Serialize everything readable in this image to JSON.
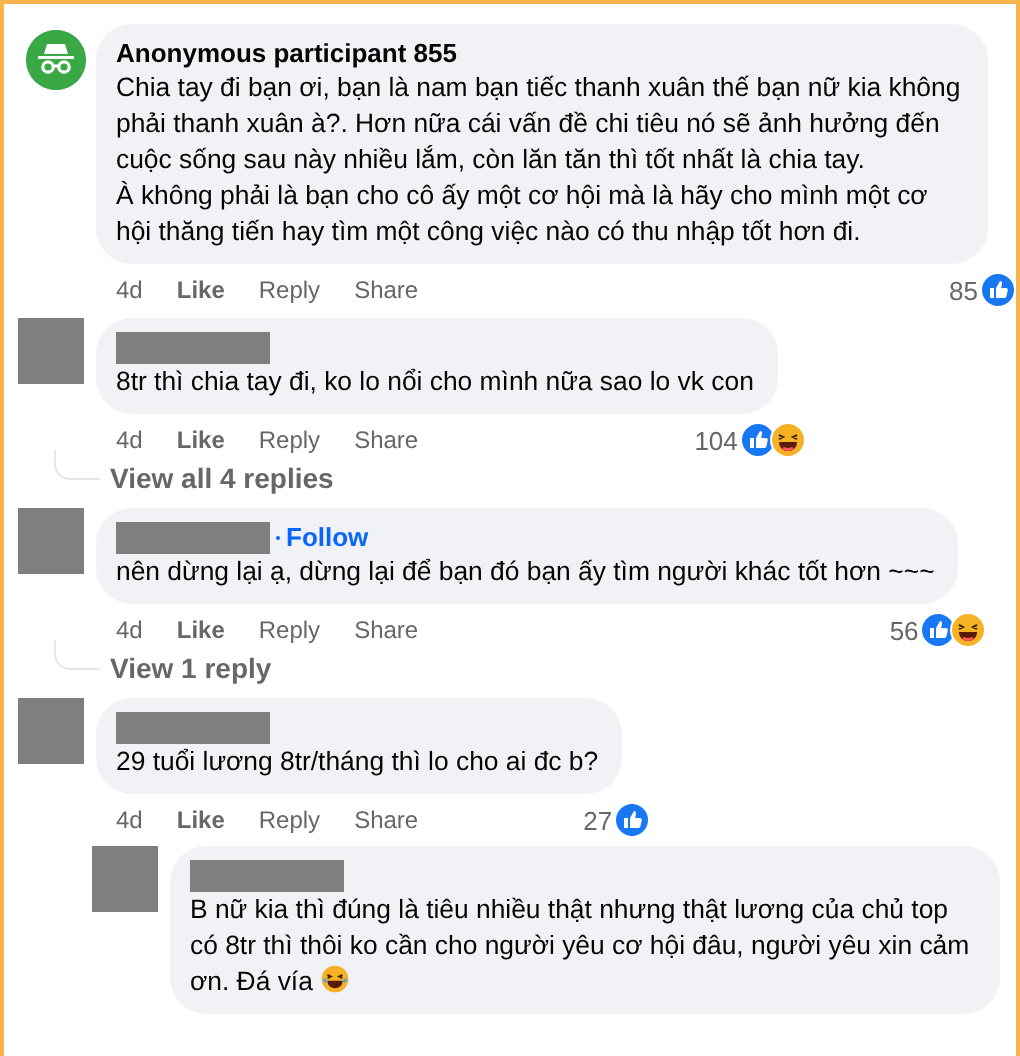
{
  "comments": [
    {
      "avatar": {
        "kind": "incognito"
      },
      "name": "Anonymous participant 855",
      "text": "Chia tay đi bạn ơi, bạn là nam bạn tiếc thanh xuân thế bạn nữ kia không phải thanh xuân à?. Hơn nữa cái vấn đề chi tiêu nó sẽ ảnh hưởng đến cuộc sống sau này nhiều lắm, còn lăn tăn thì tốt nhất là chia tay.\nÀ không phải là bạn cho cô ấy một cơ hội mà là hãy cho mình một cơ hội thăng tiến hay tìm một công việc nào có thu nhập tốt hơn đi.",
      "time": "4d",
      "actions": [
        "Like",
        "Reply",
        "Share"
      ],
      "reaction_count": "85",
      "reactions": [
        {
          "kind": "like"
        }
      ]
    },
    {
      "avatar": {
        "kind": "redacted"
      },
      "text": "8tr thì chia tay đi, ko lo nổi cho mình nữa sao lo vk con",
      "time": "4d",
      "actions": [
        "Like",
        "Reply",
        "Share"
      ],
      "reaction_count": "104",
      "reactions": [
        {
          "kind": "like"
        },
        {
          "kind": "haha"
        }
      ],
      "more_replies": "View all 4 replies"
    },
    {
      "avatar": {
        "kind": "redacted"
      },
      "follow": "Follow",
      "text": "nên dừng lại ạ, dừng lại để bạn đó bạn ấy tìm người khác tốt hơn ~~~",
      "time": "4d",
      "actions": [
        "Like",
        "Reply",
        "Share"
      ],
      "reaction_count": "56",
      "reactions": [
        {
          "kind": "like"
        },
        {
          "kind": "haha"
        }
      ],
      "more_replies": "View 1 reply"
    },
    {
      "avatar": {
        "kind": "redacted"
      },
      "text": "29 tuổi lương 8tr/tháng thì lo cho ai đc b?",
      "time": "4d",
      "actions": [
        "Like",
        "Reply",
        "Share"
      ],
      "reaction_count": "27",
      "reactions": [
        {
          "kind": "like"
        }
      ],
      "replies": [
        {
          "avatar": {
            "kind": "redacted"
          },
          "text": "B nữ kia thì đúng là tiêu nhiều thật nhưng thật lương của chủ top có 8tr thì thôi ko cần cho người yêu cơ hội đâu, người yêu xin cảm ơn. Đá vía",
          "trailing_emoji": true
        }
      ]
    }
  ]
}
